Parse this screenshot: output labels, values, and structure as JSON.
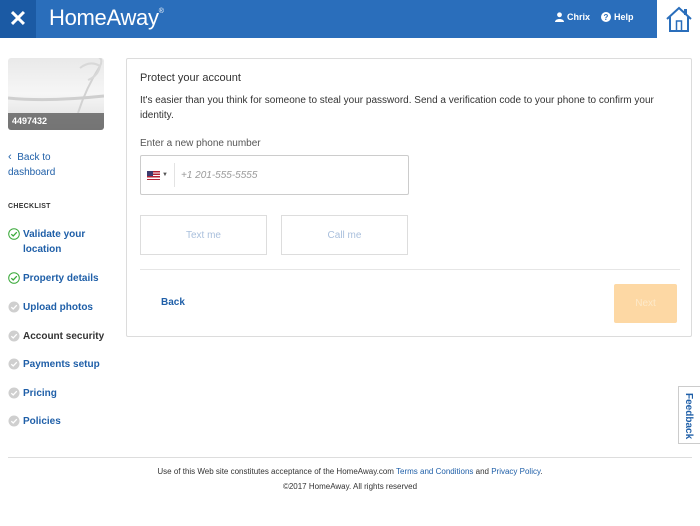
{
  "header": {
    "close_icon": "✕",
    "logo": "HomeAway",
    "logo_mark": "®",
    "user_name": "Chrix",
    "help_label": "Help",
    "colors": {
      "bar": "#2a6ebb",
      "close_bg": "#1b5aa4"
    }
  },
  "sidebar": {
    "property_id": "4497432",
    "back_label": "Back to dashboard",
    "checklist_title": "CHECKLIST",
    "steps": [
      {
        "label": "Validate your location",
        "status": "done"
      },
      {
        "label": "Property details",
        "status": "done"
      },
      {
        "label": "Upload photos",
        "status": "pending"
      },
      {
        "label": "Account security",
        "status": "current"
      },
      {
        "label": "Payments setup",
        "status": "pending"
      },
      {
        "label": "Pricing",
        "status": "pending"
      },
      {
        "label": "Policies",
        "status": "pending"
      }
    ]
  },
  "main": {
    "title": "Protect your account",
    "description": "It's easier than you think for someone to steal your password. Send a verification code to your phone to confirm your identity.",
    "phone_label": "Enter a new phone number",
    "phone_placeholder": "+1 201-555-5555",
    "country": "US",
    "text_me": "Text me",
    "call_me": "Call me",
    "back": "Back",
    "next": "Next"
  },
  "feedback": "Feedback",
  "footer": {
    "prefix": "Use of this Web site constitutes acceptance of the HomeAway.com ",
    "terms": "Terms and Conditions",
    "and": " and ",
    "privacy": "Privacy Policy",
    "suffix": ".",
    "copyright": "©2017 HomeAway. All rights reserved"
  }
}
